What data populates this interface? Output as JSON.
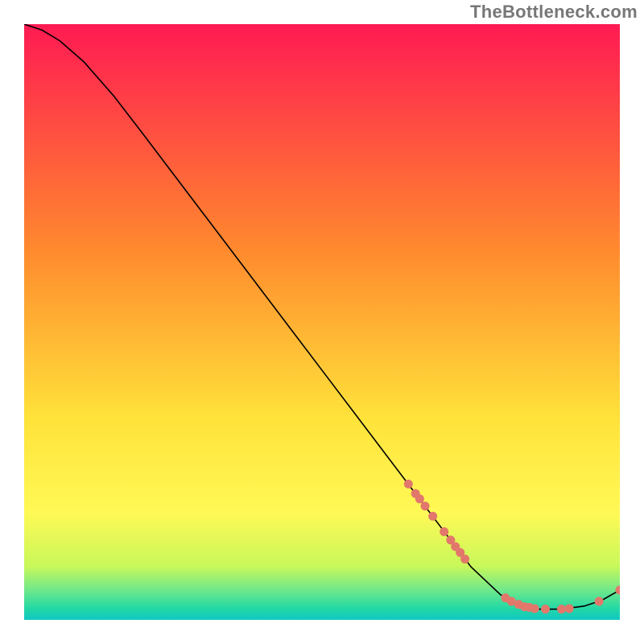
{
  "watermark": "TheBottleneck.com",
  "chart_data": {
    "type": "line",
    "title": "",
    "xlabel": "",
    "ylabel": "",
    "xlim": [
      0,
      100
    ],
    "ylim": [
      0,
      100
    ],
    "grid": false,
    "legend": false,
    "gradient": {
      "top": "#ff1a52",
      "mid_upper": "#ff8a2e",
      "mid": "#ffe23a",
      "mid_lower": "#fff956",
      "low1": "#c8f85a",
      "low2": "#6fe88b",
      "low3": "#25d9a4",
      "bottom": "#0fc7c2"
    },
    "curve": {
      "description": "Black curve: steep quasi-linear decline from top-left to a minimum near x≈88, then slight rise to the right edge.",
      "points": [
        {
          "x": 0.0,
          "y": 100.0
        },
        {
          "x": 3.0,
          "y": 99.0
        },
        {
          "x": 6.0,
          "y": 97.2
        },
        {
          "x": 10.0,
          "y": 93.7
        },
        {
          "x": 15.0,
          "y": 88.0
        },
        {
          "x": 20.0,
          "y": 81.5
        },
        {
          "x": 25.0,
          "y": 74.9
        },
        {
          "x": 30.0,
          "y": 68.3
        },
        {
          "x": 35.0,
          "y": 61.7
        },
        {
          "x": 40.0,
          "y": 55.1
        },
        {
          "x": 45.0,
          "y": 48.5
        },
        {
          "x": 50.0,
          "y": 41.9
        },
        {
          "x": 55.0,
          "y": 35.3
        },
        {
          "x": 60.0,
          "y": 28.7
        },
        {
          "x": 65.0,
          "y": 22.1
        },
        {
          "x": 70.0,
          "y": 15.5
        },
        {
          "x": 75.0,
          "y": 8.9
        },
        {
          "x": 80.0,
          "y": 4.2
        },
        {
          "x": 83.0,
          "y": 2.5
        },
        {
          "x": 86.0,
          "y": 1.8
        },
        {
          "x": 90.0,
          "y": 1.8
        },
        {
          "x": 94.0,
          "y": 2.3
        },
        {
          "x": 97.0,
          "y": 3.3
        },
        {
          "x": 100.0,
          "y": 5.0
        }
      ]
    },
    "markers": {
      "description": "Salmon/coral dot markers scattered along the lower-right portion of the curve.",
      "color": "#e2776b",
      "radius": 5.5,
      "points": [
        {
          "x": 64.5,
          "y": 22.8
        },
        {
          "x": 65.7,
          "y": 21.2
        },
        {
          "x": 66.4,
          "y": 20.3
        },
        {
          "x": 67.3,
          "y": 19.1
        },
        {
          "x": 68.6,
          "y": 17.4
        },
        {
          "x": 70.5,
          "y": 14.8
        },
        {
          "x": 71.6,
          "y": 13.4
        },
        {
          "x": 72.4,
          "y": 12.3
        },
        {
          "x": 73.2,
          "y": 11.3
        },
        {
          "x": 74.0,
          "y": 10.2
        },
        {
          "x": 80.8,
          "y": 3.7
        },
        {
          "x": 81.8,
          "y": 3.1
        },
        {
          "x": 83.0,
          "y": 2.6
        },
        {
          "x": 84.0,
          "y": 2.2
        },
        {
          "x": 84.8,
          "y": 2.1
        },
        {
          "x": 85.7,
          "y": 1.9
        },
        {
          "x": 87.5,
          "y": 1.8
        },
        {
          "x": 90.2,
          "y": 1.8
        },
        {
          "x": 91.5,
          "y": 1.9
        },
        {
          "x": 96.5,
          "y": 3.1
        },
        {
          "x": 100.0,
          "y": 5.0
        }
      ]
    }
  }
}
